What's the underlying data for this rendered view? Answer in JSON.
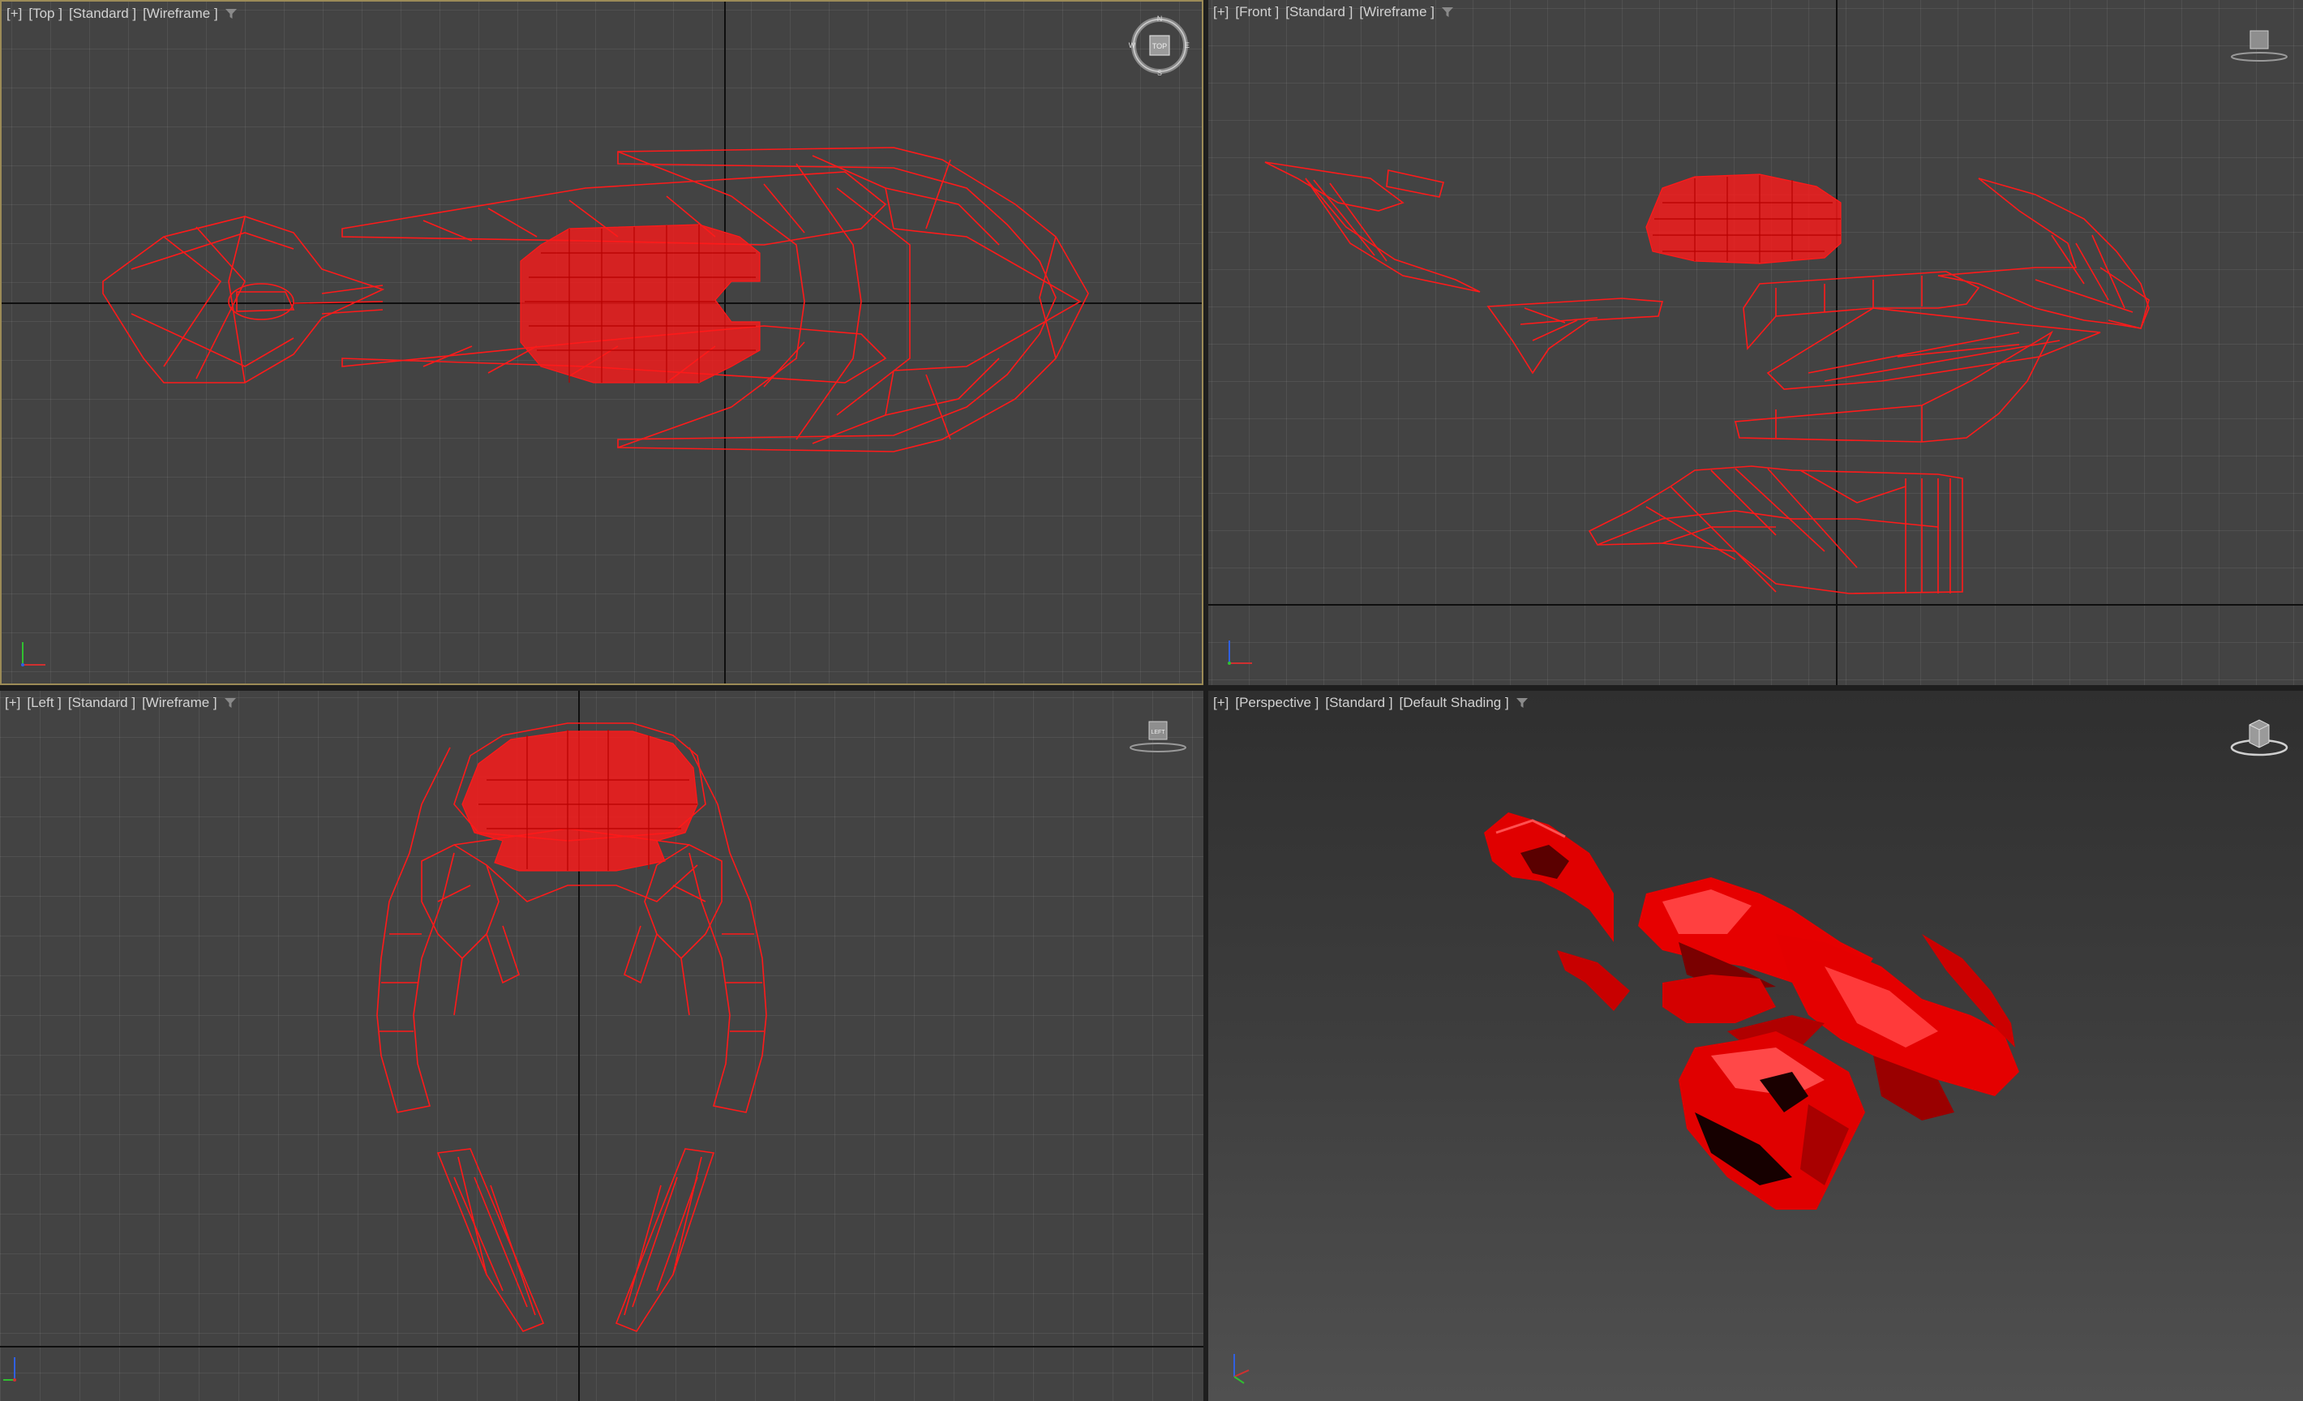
{
  "viewports": {
    "top": {
      "plus": "[+]",
      "view": "[Top ]",
      "mode": "[Standard ]",
      "shading": "[Wireframe ]"
    },
    "front": {
      "plus": "[+]",
      "view": "[Front ]",
      "mode": "[Standard ]",
      "shading": "[Wireframe ]"
    },
    "left": {
      "plus": "[+]",
      "view": "[Left ]",
      "mode": "[Standard ]",
      "shading": "[Wireframe ]"
    },
    "persp": {
      "plus": "[+]",
      "view": "[Perspective ]",
      "mode": "[Standard ]",
      "shading": "[Default Shading ]"
    }
  },
  "viewcube": {
    "top_face": "TOP",
    "compass": [
      "N",
      "E",
      "S",
      "W"
    ],
    "cube_face": "LEFT"
  },
  "colors": {
    "wireframe": "#ff1a1a",
    "shaded": "#e00000",
    "grid_bg": "#434343",
    "active_border": "#9c8b57",
    "axis_x": "#d03030",
    "axis_y": "#30c030",
    "axis_z": "#3060e0"
  },
  "icons": [
    "filter-icon",
    "viewcube-gizmo",
    "axis-tripod"
  ]
}
